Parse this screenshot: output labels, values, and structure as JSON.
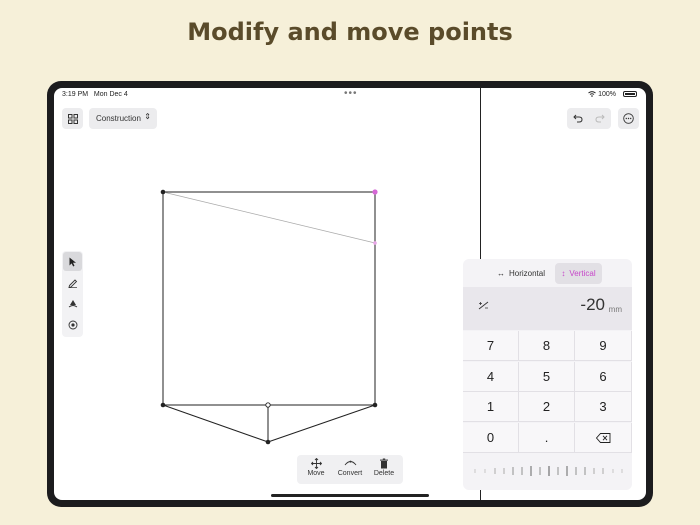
{
  "headline": "Modify and move points",
  "status": {
    "time": "3:19 PM",
    "date": "Mon Dec 4",
    "battery": "100%"
  },
  "toolbar": {
    "layer": "Construction"
  },
  "point_actions": {
    "move": "Move",
    "convert": "Convert",
    "delete": "Delete"
  },
  "numpad": {
    "tab_horizontal": "Horizontal",
    "tab_vertical": "Vertical",
    "selected_tab": "Vertical",
    "sign": "+/-",
    "value": "-20",
    "unit": "mm",
    "keys": [
      {
        "label": "7"
      },
      {
        "label": "8"
      },
      {
        "label": "9"
      },
      {
        "label": "4"
      },
      {
        "label": "5"
      },
      {
        "label": "6"
      },
      {
        "label": "1"
      },
      {
        "label": "2"
      },
      {
        "label": "3"
      },
      {
        "label": "0"
      },
      {
        "label": "."
      },
      {
        "label": ""
      }
    ]
  },
  "colors": {
    "accent": "#c646c9",
    "background": "#f6f0d9",
    "headline": "#5a4b2a"
  },
  "icons": [
    "grid-icon",
    "chevron-updown-icon",
    "undo-icon",
    "redo-icon",
    "more-icon",
    "pointer-icon",
    "pen-icon",
    "anchor-icon",
    "target-icon",
    "move-icon",
    "convert-icon",
    "trash-icon",
    "backspace-icon",
    "wifi-icon",
    "battery-icon",
    "horizontal-arrows-icon",
    "vertical-arrows-icon"
  ]
}
